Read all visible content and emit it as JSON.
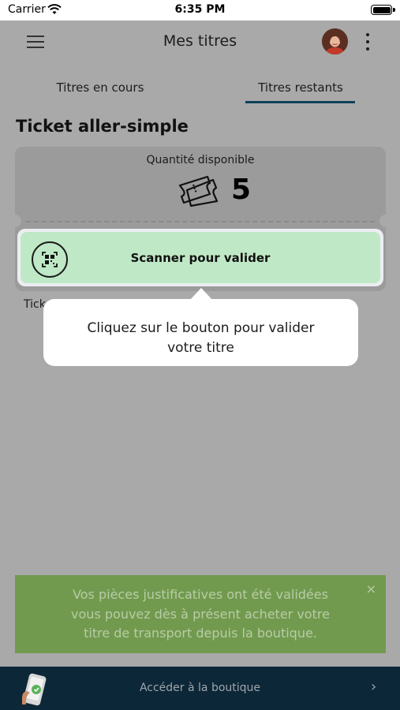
{
  "status_bar": {
    "carrier": "Carrier",
    "time": "6:35 PM"
  },
  "header": {
    "title": "Mes titres",
    "menu_icon": "hamburger-menu-icon",
    "more_icon": "more-vertical-icon"
  },
  "tabs": [
    {
      "label": "Titres en cours",
      "active": false
    },
    {
      "label": "Titres restants",
      "active": true
    }
  ],
  "section": {
    "title": "Ticket aller-simple"
  },
  "ticket": {
    "quantity_label": "Quantité disponible",
    "quantity_value": "5",
    "partial_text": "Tick"
  },
  "scan": {
    "label": "Scanner pour valider",
    "icon": "qr-scan-icon"
  },
  "tooltip": {
    "line1": "Cliquez sur le bouton pour valider",
    "line2": "votre titre"
  },
  "banner": {
    "line1": "Vos pièces justificatives ont été validées",
    "line2": "vous pouvez dès à présent acheter votre",
    "line3": "titre de transport depuis la boutique.",
    "close": "×"
  },
  "shop": {
    "label": "Accéder à la boutique",
    "chevron": "›"
  },
  "colors": {
    "accent": "#0e4259",
    "scan_bg": "#bfe9c6",
    "banner_bg": "#729a4f",
    "shop_bg": "#0c2738"
  }
}
